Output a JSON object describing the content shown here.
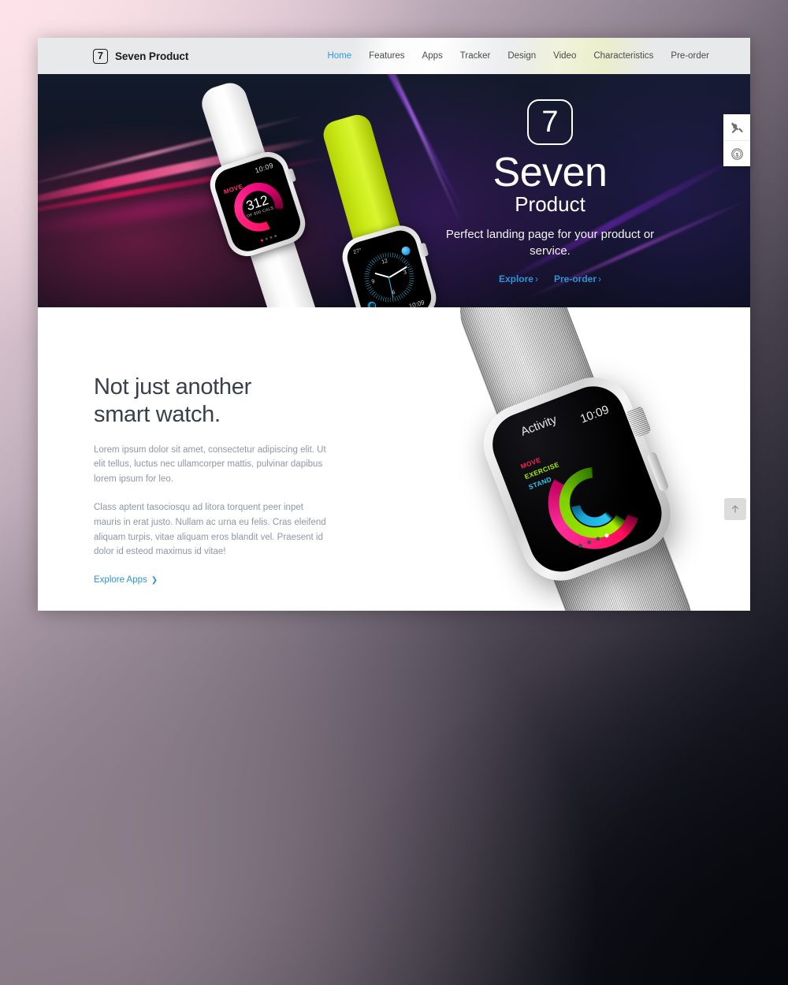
{
  "header": {
    "logo_badge": "7",
    "brand_name": "Seven Product",
    "nav": [
      {
        "label": "Home",
        "active": true
      },
      {
        "label": "Features",
        "active": false
      },
      {
        "label": "Apps",
        "active": false
      },
      {
        "label": "Tracker",
        "active": false
      },
      {
        "label": "Design",
        "active": false
      },
      {
        "label": "Video",
        "active": false
      },
      {
        "label": "Characteristics",
        "active": false
      },
      {
        "label": "Pre-order",
        "active": false
      }
    ]
  },
  "hero": {
    "badge": "7",
    "title": "Seven",
    "subtitle": "Product",
    "tagline": "Perfect landing page for your product or service.",
    "cta_primary": "Explore",
    "cta_secondary": "Pre-order",
    "chevron": "›",
    "watch_move": {
      "time": "10:09",
      "label": "MOVE",
      "calories": "312",
      "calories_sub": "OF 600 CALS"
    },
    "watch_clock": {
      "temperature": "27°",
      "time": "10:09",
      "hour_12": "12",
      "hour_3": "3",
      "hour_6": "6",
      "hour_9": "9"
    }
  },
  "side_toolbar": {
    "tools_icon": "tools-icon",
    "pricing_icon": "dollar-coin-icon"
  },
  "content": {
    "heading_line1": "Not just another",
    "heading_line2": "smart watch.",
    "paragraph1": "Lorem ipsum dolor sit amet, consectetur adipiscing elit. Ut elit tellus, luctus nec ullamcorper mattis, pulvinar dapibus lorem ipsum for leo.",
    "paragraph2": "Class aptent tasociosqu ad litora torquent peer inpet mauris in erat justo. Nullam ac urna eu felis. Cras eleifend aliquam turpis, vitae aliquam eros blandit vel. Praesent id dolor id esteod maximus id vitae!",
    "link_label": "Explore Apps",
    "link_chevron": "❯",
    "big_watch": {
      "app_title": "Activity",
      "time": "10:09",
      "ring_move": "MOVE",
      "ring_exercise": "EXERCISE",
      "ring_stand": "STAND"
    }
  },
  "scroll_top": {
    "icon": "arrow-up-icon"
  },
  "colors": {
    "accent_blue": "#2f93d8",
    "hero_bg": "#131a2b",
    "header_bg": "#e8e9eb",
    "heading": "#39404a",
    "body_text": "#8f96a3",
    "ring_move": "#ff1f5a",
    "ring_exercise": "#a6f000",
    "ring_stand": "#28c8f0"
  }
}
